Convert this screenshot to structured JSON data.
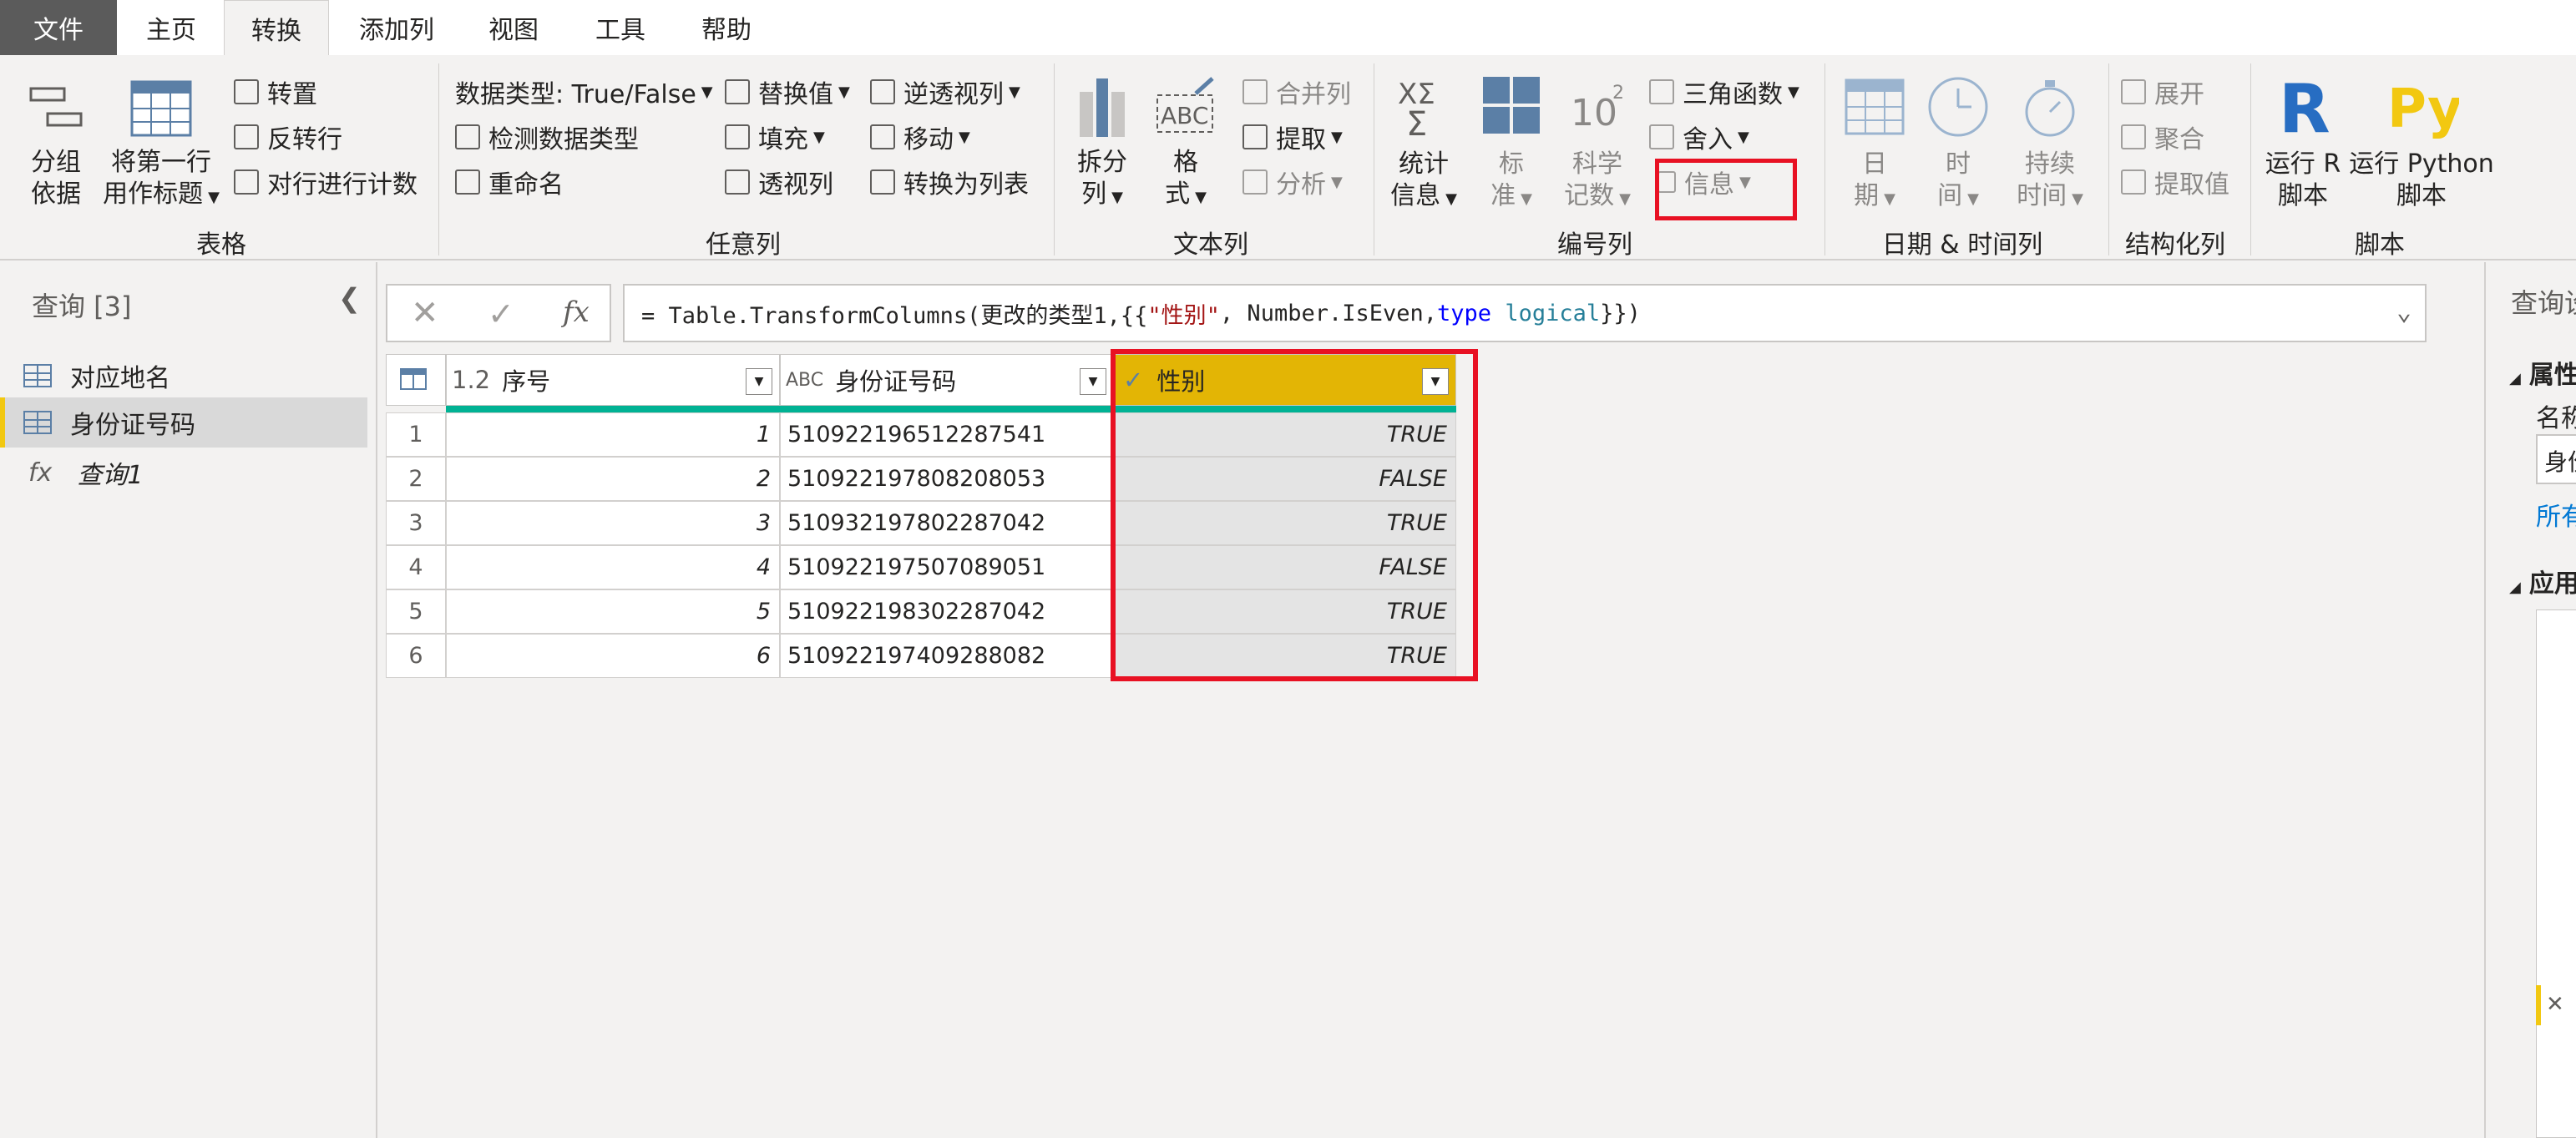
{
  "tabs": [
    "文件",
    "主页",
    "转换",
    "添加列",
    "视图",
    "工具",
    "帮助"
  ],
  "ribbon": {
    "table_group": {
      "label": "表格",
      "group_by": [
        "分组",
        "依据"
      ],
      "first_row_header": [
        "将第一行",
        "用作标题"
      ],
      "transpose": "转置",
      "reverse_rows": "反转行",
      "count_rows": "对行进行计数"
    },
    "any_column_group": {
      "label": "任意列",
      "data_type": "数据类型: True/False",
      "detect_type": "检测数据类型",
      "rename": "重命名",
      "replace_values": "替换值",
      "fill": "填充",
      "pivot": "透视列",
      "unpivot": "逆透视列",
      "move": "移动",
      "to_list": "转换为列表"
    },
    "text_group": {
      "label": "文本列",
      "split": [
        "拆分",
        "列"
      ],
      "format": [
        "格",
        "式"
      ],
      "merge": "合并列",
      "extract": "提取",
      "parse": "分析"
    },
    "number_group": {
      "label": "编号列",
      "statistics": [
        "统计",
        "信息"
      ],
      "standard": [
        "标",
        "准"
      ],
      "scientific": [
        "科学",
        "记数"
      ],
      "trig": "三角函数",
      "rounding": "舍入",
      "information": "信息"
    },
    "datetime_group": {
      "label": "日期 & 时间列",
      "date": [
        "日",
        "期"
      ],
      "time": [
        "时",
        "间"
      ],
      "duration": [
        "持续",
        "时间"
      ]
    },
    "structured_group": {
      "label": "结构化列",
      "expand": "展开",
      "aggregate": "聚合",
      "extract_values": "提取值"
    },
    "script_group": {
      "label": "脚本",
      "run_r": [
        "运行 R",
        "脚本"
      ],
      "run_python": [
        "运行 Python",
        "脚本"
      ]
    }
  },
  "queries": {
    "title": "查询 [3]",
    "items": [
      "对应地名",
      "身份证号码",
      "查询1"
    ]
  },
  "formula": {
    "fx": "fx",
    "p1": "= Table.TransformColumns(更改的类型1,{{",
    "s1": "\"性别\"",
    "p2": ", Number.IsEven, ",
    "kw": "type",
    "p3": " ",
    "t1": "logical",
    "p4": "}})"
  },
  "grid": {
    "columns": [
      {
        "type": "1.2",
        "name": "序号"
      },
      {
        "type": "ABC",
        "name": "身份证号码"
      },
      {
        "type": "✓",
        "name": "性别"
      }
    ],
    "rows": [
      {
        "n": "1",
        "id": "1",
        "card": "510922196512287541",
        "gender": "TRUE"
      },
      {
        "n": "2",
        "id": "2",
        "card": "510922197808208053",
        "gender": "FALSE"
      },
      {
        "n": "3",
        "id": "3",
        "card": "510932197802287042",
        "gender": "TRUE"
      },
      {
        "n": "4",
        "id": "4",
        "card": "510922197507089051",
        "gender": "FALSE"
      },
      {
        "n": "5",
        "id": "5",
        "card": "510922198302287042",
        "gender": "TRUE"
      },
      {
        "n": "6",
        "id": "6",
        "card": "510922197409288082",
        "gender": "TRUE"
      }
    ]
  },
  "right_pane": {
    "title": "查询设",
    "props": "属性",
    "name_label": "名称",
    "name_value": "身份",
    "all_props": "所有",
    "applied": "应用"
  },
  "colors": {
    "accent": "#f2c811",
    "selected_header": "#e3b505",
    "highlight": "#e81123",
    "quality_bar": "#00b294"
  }
}
